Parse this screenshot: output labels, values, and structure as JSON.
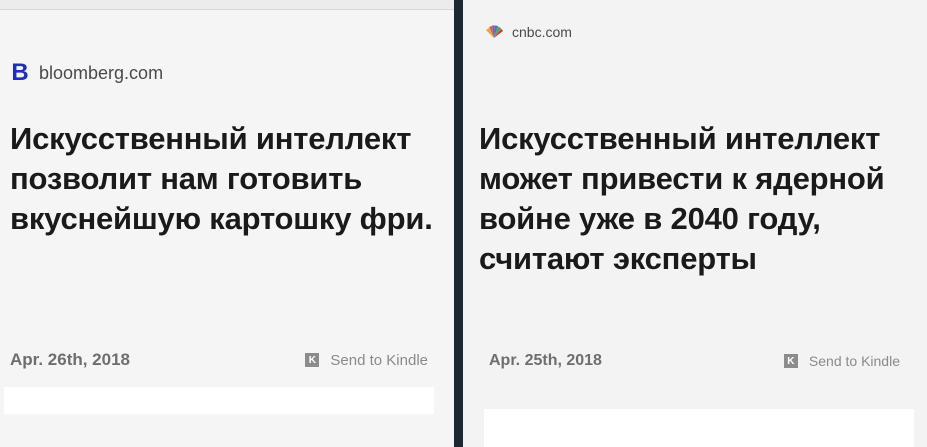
{
  "left": {
    "source": "bloomberg.com",
    "logo_letter": "B",
    "headline": "Искусственный интеллект позволит нам готовить вкуснейшую картошку фри.",
    "date": "Apr. 26th, 2018",
    "kindle_label": "Send to Kindle",
    "kindle_icon": "K"
  },
  "right": {
    "source": "cnbc.com",
    "headline": "Искусственный интеллект может привести к ядерной войне уже в 2040 году, считают эксперты",
    "date": "Apr. 25th, 2018",
    "kindle_label": "Send to Kindle",
    "kindle_icon": "K"
  },
  "colors": {
    "bloomberg_logo": "#1e2fb8",
    "divider": "#1d2733",
    "background": "#f5f5f5"
  }
}
